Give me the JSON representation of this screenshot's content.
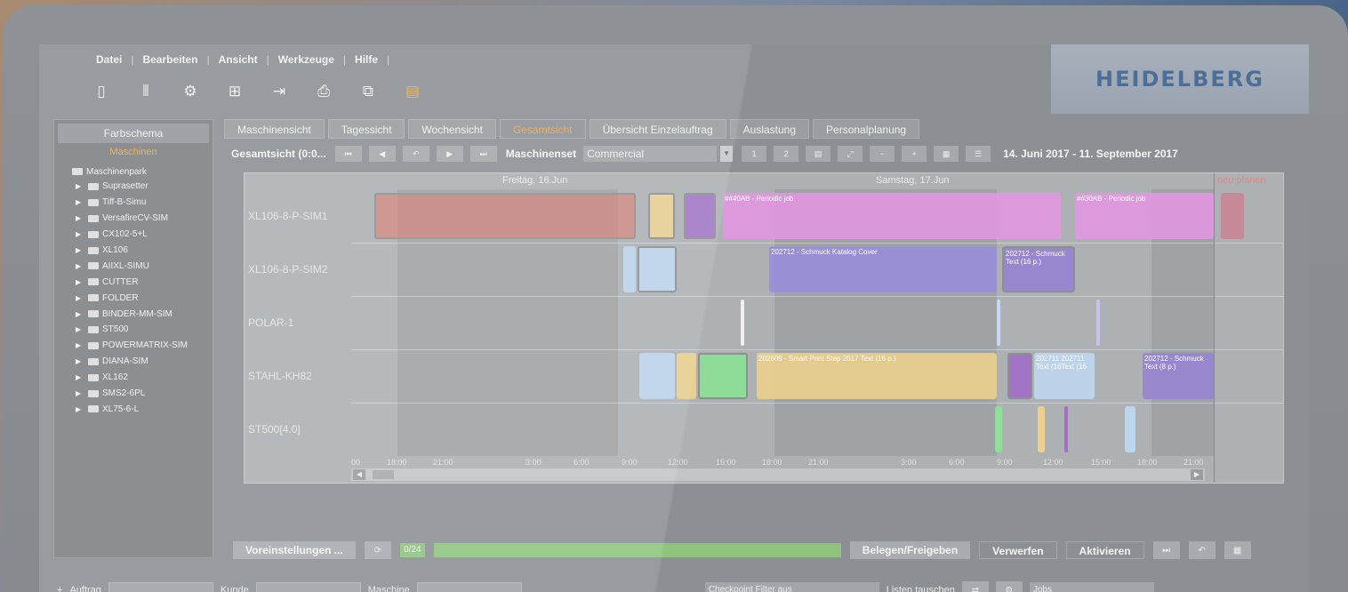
{
  "menu": [
    "Datei",
    "Bearbeiten",
    "Ansicht",
    "Werkzeuge",
    "Hilfe"
  ],
  "toolbar_icons": [
    "document-icon",
    "stack-icon",
    "settings-doc-icon",
    "org-chart-icon",
    "export-icon",
    "printer-icon",
    "chart-icon",
    "highlight-doc-icon"
  ],
  "brand": "HEIDELBERG",
  "left_panel": {
    "title": "Farbschema",
    "subtitle": "Maschinen",
    "root": "Maschinenpark",
    "items": [
      "Suprasetter",
      "Tiff-B-Simu",
      "VersafireCV-SIM",
      "CX102-5+L",
      "XL106",
      "AIIXL-SIMU",
      "CUTTER",
      "FOLDER",
      "BINDER-MM-SIM",
      "ST500",
      "POWERMATRIX-SIM",
      "DIANA-SIM",
      "XL162",
      "SMS2-6PL",
      "XL75-6-L"
    ]
  },
  "tabs": [
    "Maschinensicht",
    "Tagessicht",
    "Wochensicht",
    "Gesamtsicht",
    "Übersicht Einzelauftrag",
    "Auslastung",
    "Personalplanung"
  ],
  "active_tab": "Gesamtsicht",
  "gantt_toolbar": {
    "label": "Gesamtsicht",
    "label_extra": "(0:0...",
    "machineset_label": "Maschinenset",
    "machineset_value": "Commercial",
    "btn1": "1",
    "btn2": "2",
    "date_range": "14. Juni 2017 - 11. September 2017"
  },
  "chart": {
    "day1": "Freitag, 16.Jun",
    "day2": "Samstag, 17.Jun",
    "neu_planen": "neu planen",
    "rows": [
      "XL106-8-P-SIM1",
      "XL106-8-P-SIM2",
      "POLAR-1",
      "STAHL-KH82",
      "ST500[4.0]"
    ],
    "ticks": [
      "00",
      "18:00",
      "21:00",
      "3:00",
      "6:00",
      "9:00",
      "12:00",
      "15:00",
      "18:00",
      "21:00",
      "3:00",
      "6:00",
      "9:00",
      "12:00",
      "15:00",
      "18:00",
      "21:00"
    ],
    "job_labels": {
      "a": "##40AB - Periodic job",
      "b": "##30AB - Periodic job",
      "c": "202712 - Schmuck Katalog Cover",
      "d": "202712 - Schmuck Text (16 p.)",
      "e": "202609 - Smart Print Step 2017 Text (16 p.)",
      "f": "202711 202711 Text (16Text (16",
      "g": "202712 - Schmuck Text (8 p.)"
    }
  },
  "bottom": {
    "defaults_btn": "Voreinstellungen ...",
    "count": "0/24",
    "assign_btn": "Belegen/Freigeben",
    "discard_btn": "Verwerfen",
    "refresh_btn": "Aktivieren"
  },
  "filters": {
    "auftrag": "Auftrag",
    "kunde": "Kunde",
    "maschine": "Maschine",
    "checkpoint": "Checkpoint Filter aus",
    "listen": "Listen tauschen",
    "last": "Jobs"
  }
}
